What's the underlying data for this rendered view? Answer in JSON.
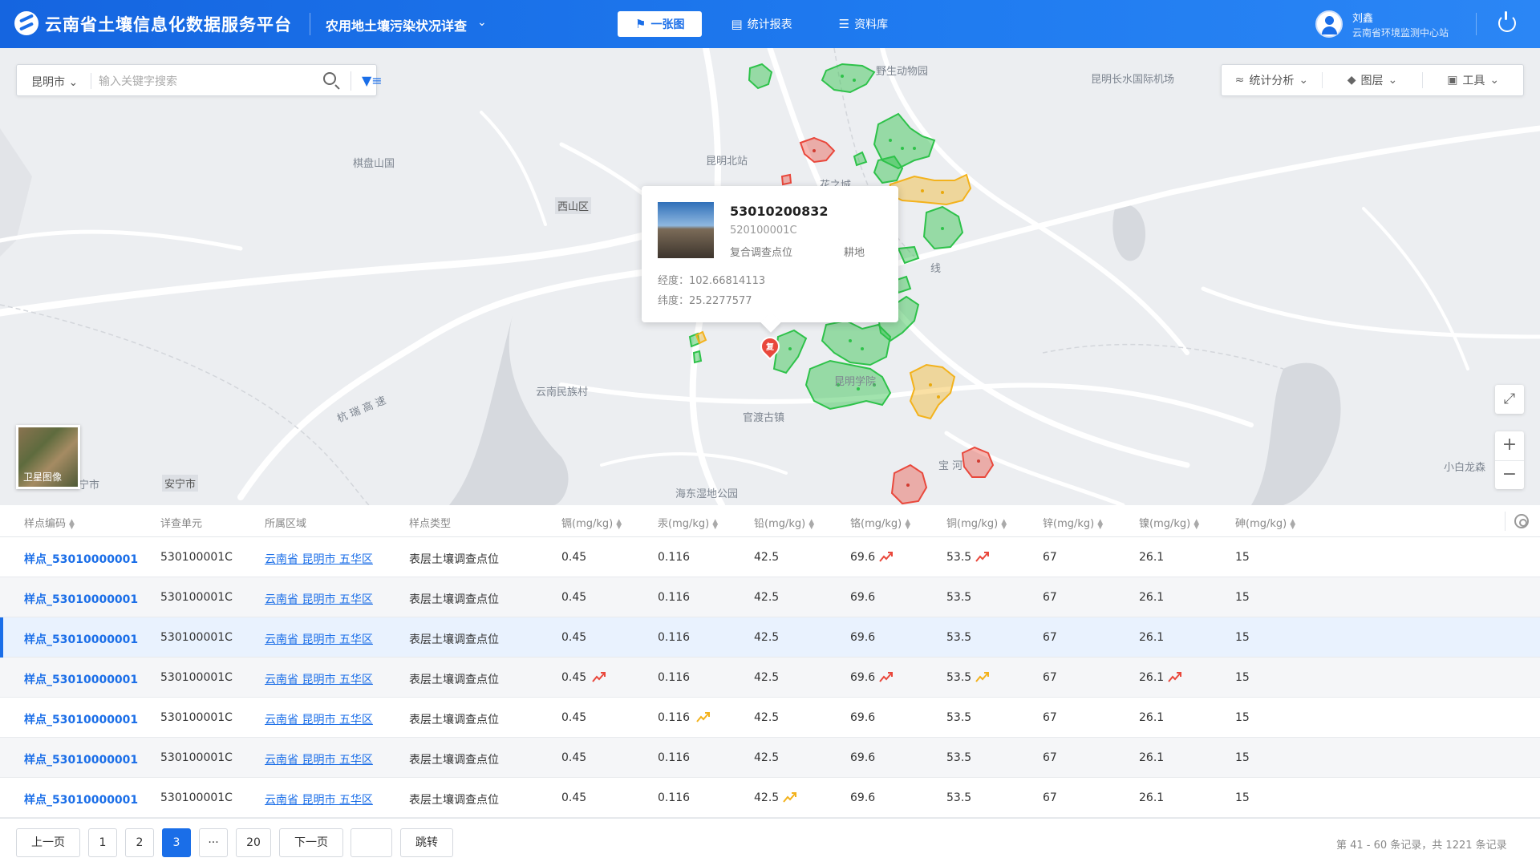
{
  "header": {
    "app_title": "云南省土壤信息化数据服务平台",
    "module_title": "农用地土壤污染状况详查",
    "nav": [
      {
        "label": "一张图",
        "icon": "map-user-icon",
        "active": true
      },
      {
        "label": "统计报表",
        "icon": "bar-chart-icon",
        "active": false
      },
      {
        "label": "资料库",
        "icon": "database-icon",
        "active": false
      }
    ],
    "user": {
      "name": "刘鑫",
      "org": "云南省环境监测中心站"
    }
  },
  "map": {
    "search": {
      "city": "昆明市",
      "placeholder": "输入关键字搜索"
    },
    "tools": [
      {
        "label": "统计分析",
        "icon": "layers-stack-icon"
      },
      {
        "label": "图层",
        "icon": "layer-icon"
      },
      {
        "label": "工具",
        "icon": "toolbox-icon"
      }
    ],
    "labels": {
      "zoo": "野生动物园",
      "airport": "昆明长水国际机场",
      "north_station": "昆明北站",
      "botanical": "棋盘山国",
      "xishan": "西山区",
      "huazhicheng": "花之城",
      "expressway": "杭 瑞 高 速",
      "ethnic_village": "云南民族村",
      "guandu": "官渡古镇",
      "university_town": "昆明学院",
      "anning": "安宁市",
      "anning_town": "宁市",
      "wetland": "海东湿地公园",
      "xiaobailong": "小白龙森",
      "road_line": "线",
      "river": "宝 河"
    },
    "popup": {
      "code": "53010200832",
      "unit": "520100001C",
      "type": "复合调查点位",
      "land": "耕地",
      "lng": "经度：102.66814113",
      "lat": "纬度：25.2277577"
    },
    "marker_text": "复",
    "satellite_label": "卫星图像",
    "colors": {
      "green": "#2ec24a",
      "orange": "#f3b21c",
      "red": "#e9483c"
    }
  },
  "table": {
    "headers": [
      "样点编码",
      "详查单元",
      "所属区域",
      "样点类型",
      "镉(mg/kg)",
      "汞(mg/kg)",
      "铅(mg/kg)",
      "铬(mg/kg)",
      "铜(mg/kg)",
      "锌(mg/kg)",
      "镍(mg/kg)",
      "砷(mg/kg)"
    ],
    "rows": [
      {
        "code": "样点_53010000001",
        "unit": "530100001C",
        "region": "云南省 昆明市 五华区",
        "type": "表层土壤调查点位",
        "cd": "0.45",
        "hg": "0.116",
        "pb": "42.5",
        "cr": "69.6",
        "cu": "53.5",
        "zn": "67",
        "ni": "26.1",
        "as": "15",
        "trends": {
          "cr": "red",
          "cu": "red"
        }
      },
      {
        "code": "样点_53010000001",
        "unit": "530100001C",
        "region": "云南省 昆明市 五华区",
        "type": "表层土壤调查点位",
        "cd": "0.45",
        "hg": "0.116",
        "pb": "42.5",
        "cr": "69.6",
        "cu": "53.5",
        "zn": "67",
        "ni": "26.1",
        "as": "15",
        "trends": {}
      },
      {
        "code": "样点_53010000001",
        "unit": "530100001C",
        "region": "云南省 昆明市 五华区",
        "type": "表层土壤调查点位",
        "cd": "0.45",
        "hg": "0.116",
        "pb": "42.5",
        "cr": "69.6",
        "cu": "53.5",
        "zn": "67",
        "ni": "26.1",
        "as": "15",
        "trends": {},
        "selected": true
      },
      {
        "code": "样点_53010000001",
        "unit": "530100001C",
        "region": "云南省 昆明市 五华区",
        "type": "表层土壤调查点位",
        "cd": "0.45",
        "hg": "0.116",
        "pb": "42.5",
        "cr": "69.6",
        "cu": "53.5",
        "zn": "67",
        "ni": "26.1",
        "as": "15",
        "trends": {
          "cd": "red",
          "cr": "red",
          "cu": "orange",
          "ni": "red"
        }
      },
      {
        "code": "样点_53010000001",
        "unit": "530100001C",
        "region": "云南省 昆明市 五华区",
        "type": "表层土壤调查点位",
        "cd": "0.45",
        "hg": "0.116",
        "pb": "42.5",
        "cr": "69.6",
        "cu": "53.5",
        "zn": "67",
        "ni": "26.1",
        "as": "15",
        "trends": {
          "hg": "orange"
        }
      },
      {
        "code": "样点_53010000001",
        "unit": "530100001C",
        "region": "云南省 昆明市 五华区",
        "type": "表层土壤调查点位",
        "cd": "0.45",
        "hg": "0.116",
        "pb": "42.5",
        "cr": "69.6",
        "cu": "53.5",
        "zn": "67",
        "ni": "26.1",
        "as": "15",
        "trends": {}
      },
      {
        "code": "样点_53010000001",
        "unit": "530100001C",
        "region": "云南省 昆明市 五华区",
        "type": "表层土壤调查点位",
        "cd": "0.45",
        "hg": "0.116",
        "pb": "42.5",
        "cr": "69.6",
        "cu": "53.5",
        "zn": "67",
        "ni": "26.1",
        "as": "15",
        "trends": {
          "pb": "orange"
        }
      }
    ],
    "trend_colors": {
      "red": "#e9483c",
      "orange": "#f3b21c"
    }
  },
  "pager": {
    "prev": "上一页",
    "pages": [
      "1",
      "2",
      "3",
      "···",
      "20"
    ],
    "current": "3",
    "next": "下一页",
    "jump": "跳转",
    "info": "第 41 - 60 条记录，共 1221 条记录"
  }
}
